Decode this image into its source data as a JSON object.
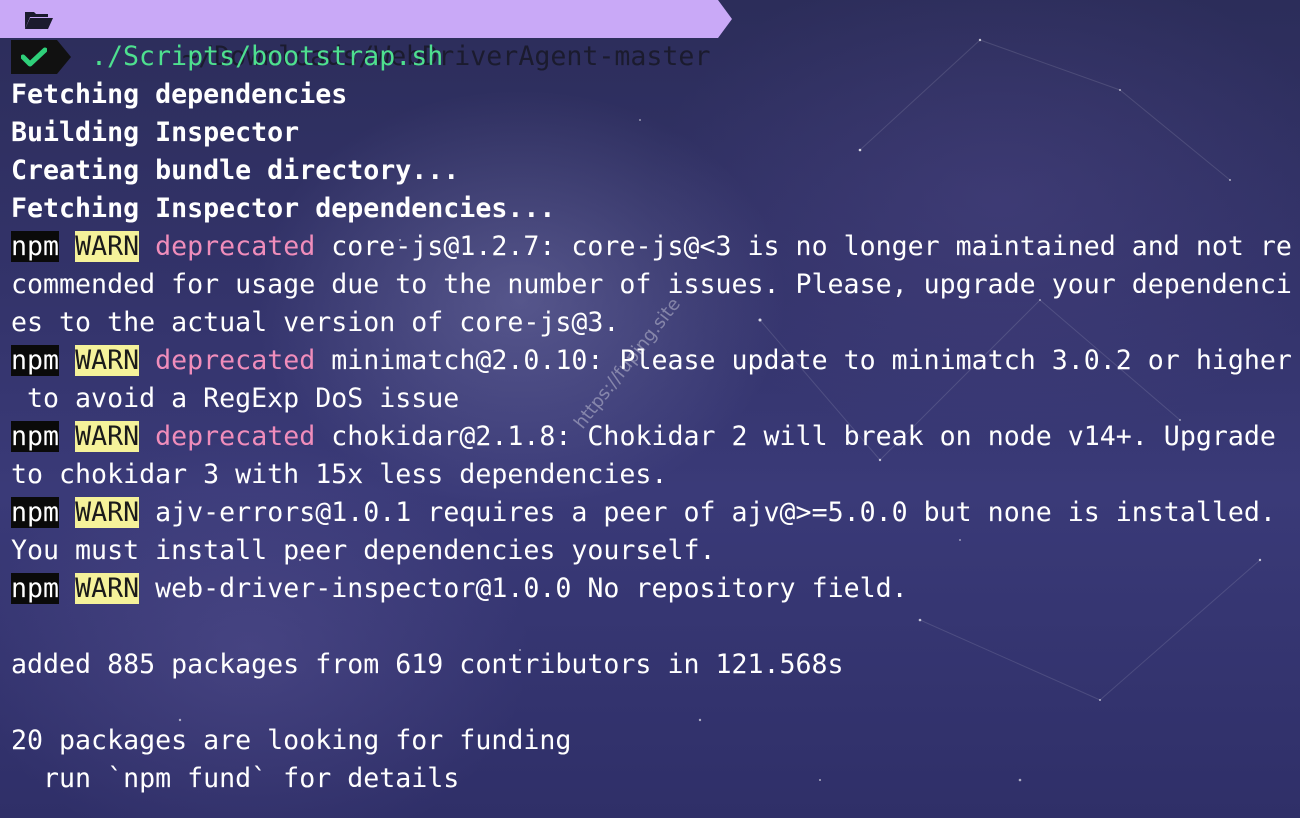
{
  "prompt": {
    "folder_icon": "folder-open-icon",
    "path": "~/Downloads/WebDriverAgent-master",
    "path_bg": "#c9a9f7",
    "status_icon": "checkmark-icon",
    "status_color": "#2fd07a",
    "command": "./Scripts/bootstrap.sh"
  },
  "steps": [
    "Fetching dependencies",
    "Building Inspector",
    "Creating bundle directory...",
    "Fetching Inspector dependencies..."
  ],
  "warnings": [
    {
      "npm": "npm",
      "level": "WARN",
      "kind": "deprecated",
      "msg_first": " core-js@1.2.7: core-js@<3 is no longer maintained and not re",
      "cont": [
        "commended for usage due to the number of issues. Please, upgrade your dependenci",
        "es to the actual version of core-js@3."
      ]
    },
    {
      "npm": "npm",
      "level": "WARN",
      "kind": "deprecated",
      "msg_first": " minimatch@2.0.10: Please update to minimatch 3.0.2 or higher",
      "cont": [
        " to avoid a RegExp DoS issue"
      ]
    },
    {
      "npm": "npm",
      "level": "WARN",
      "kind": "deprecated",
      "msg_first": " chokidar@2.1.8: Chokidar 2 will break on node v14+. Upgrade",
      "cont": [
        "to chokidar 3 with 15x less dependencies."
      ]
    },
    {
      "npm": "npm",
      "level": "WARN",
      "kind": "",
      "msg_first": " ajv-errors@1.0.1 requires a peer of ajv@>=5.0.0 but none is installed.",
      "cont": [
        "You must install peer dependencies yourself."
      ]
    },
    {
      "npm": "npm",
      "level": "WARN",
      "kind": "",
      "msg_first": " web-driver-inspector@1.0.0 No repository field.",
      "cont": []
    }
  ],
  "summary": {
    "added": "added 885 packages from 619 contributors in 121.568s",
    "funding": "20 packages are looking for funding",
    "fund_hint": "  run `npm fund` for details"
  },
  "watermark": "https://fuping.site",
  "colors": {
    "npm_bg": "#0a0a0a",
    "warn_bg": "#f5f29a",
    "deprecated": "#f08dbb",
    "command": "#4ee08f"
  }
}
